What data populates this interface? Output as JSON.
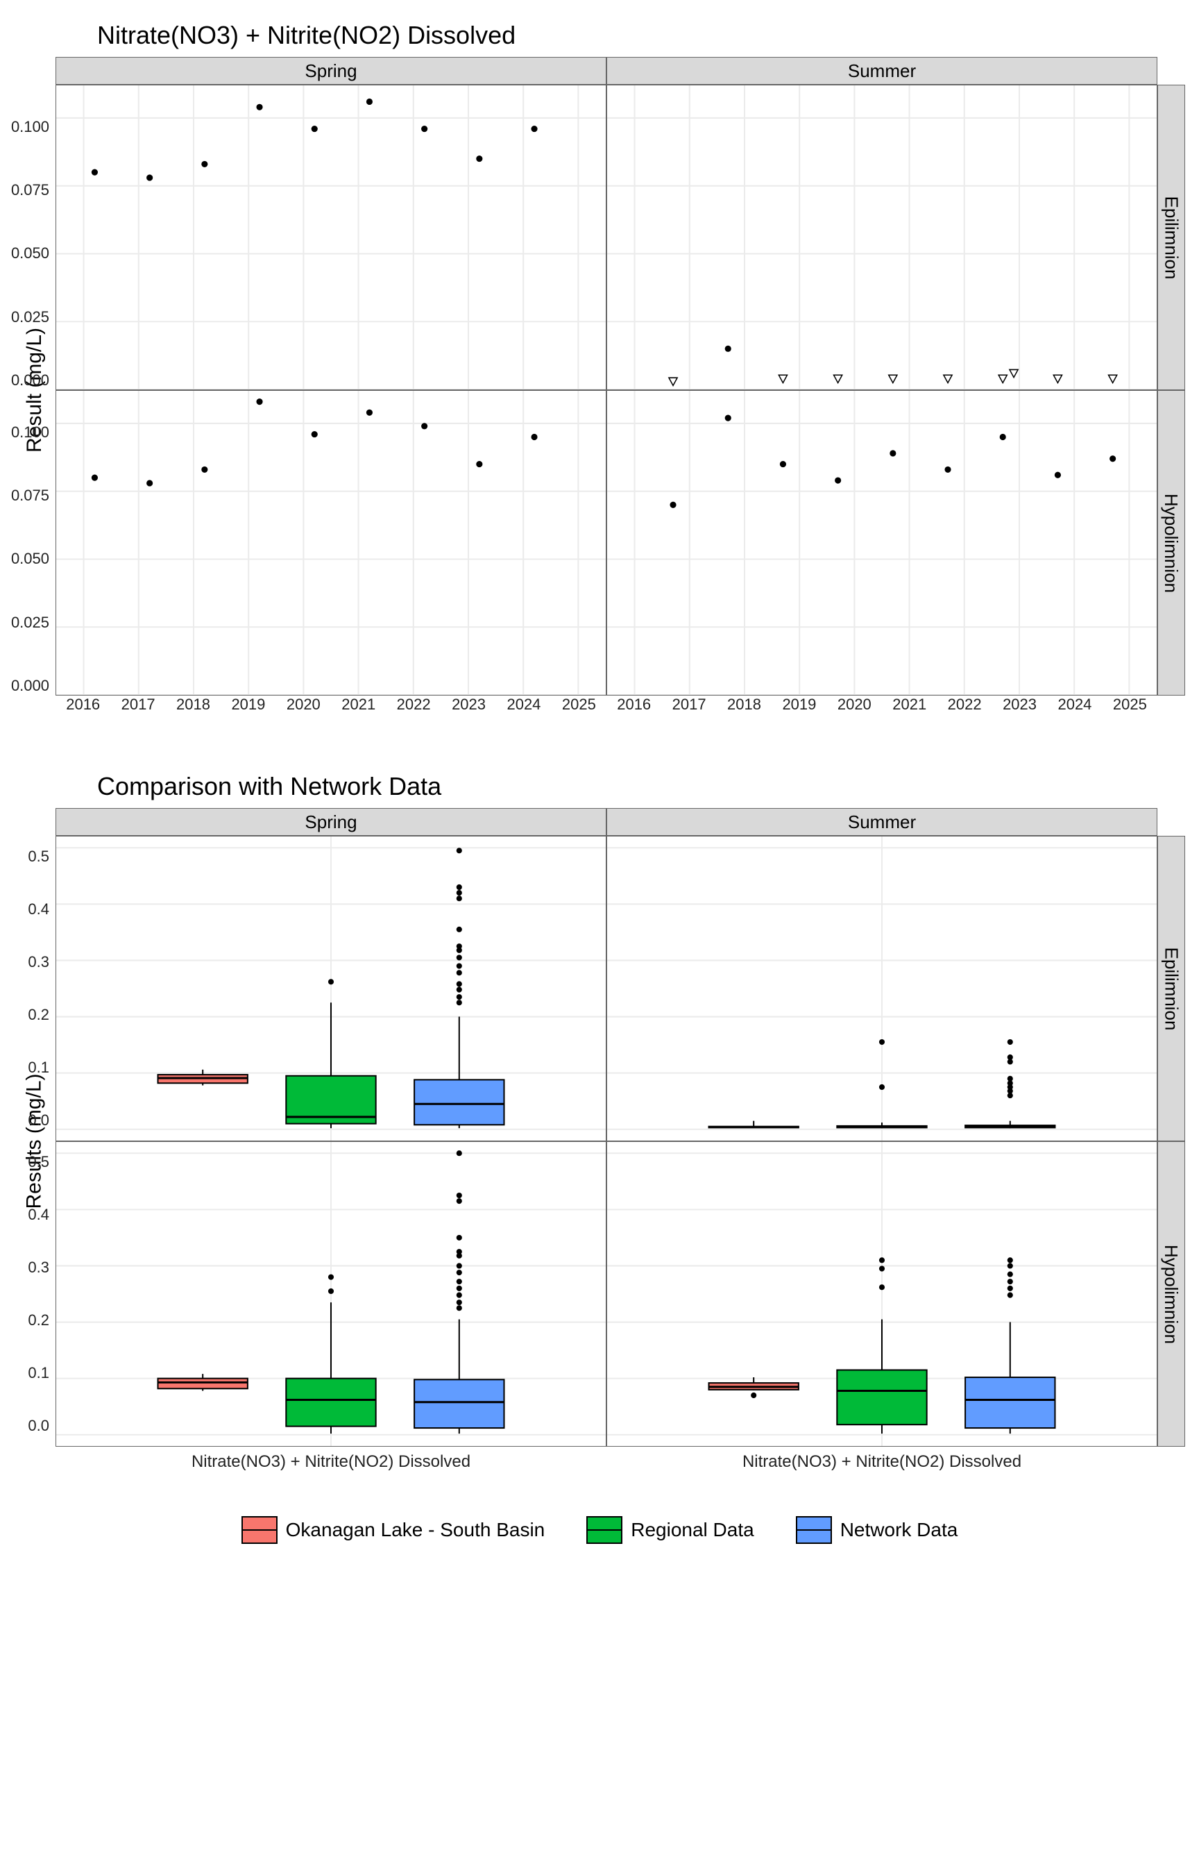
{
  "chart_data": [
    {
      "type": "scatter",
      "title": "Nitrate(NO3) + Nitrite(NO2) Dissolved",
      "ylabel": "Result (mg/L)",
      "xlim": [
        2015.5,
        2025.5
      ],
      "ylim": [
        0,
        0.112
      ],
      "x_ticks": [
        2016,
        2017,
        2018,
        2019,
        2020,
        2021,
        2022,
        2023,
        2024,
        2025
      ],
      "y_ticks": [
        0.0,
        0.025,
        0.05,
        0.075,
        0.1
      ],
      "col_facets": [
        "Spring",
        "Summer"
      ],
      "row_facets": [
        "Epilimnion",
        "Hypolimnion"
      ],
      "panels": {
        "Spring_Epilimnion": {
          "points": [
            {
              "x": 2016.2,
              "y": 0.08
            },
            {
              "x": 2017.2,
              "y": 0.078
            },
            {
              "x": 2018.2,
              "y": 0.083
            },
            {
              "x": 2019.2,
              "y": 0.104
            },
            {
              "x": 2020.2,
              "y": 0.096
            },
            {
              "x": 2021.2,
              "y": 0.106
            },
            {
              "x": 2022.2,
              "y": 0.096
            },
            {
              "x": 2023.2,
              "y": 0.085
            },
            {
              "x": 2024.2,
              "y": 0.096
            }
          ],
          "open": []
        },
        "Summer_Epilimnion": {
          "points": [
            {
              "x": 2017.7,
              "y": 0.015
            }
          ],
          "open": [
            {
              "x": 2016.7,
              "y": 0.003
            },
            {
              "x": 2018.7,
              "y": 0.004
            },
            {
              "x": 2019.7,
              "y": 0.004
            },
            {
              "x": 2020.7,
              "y": 0.004
            },
            {
              "x": 2021.7,
              "y": 0.004
            },
            {
              "x": 2022.7,
              "y": 0.004
            },
            {
              "x": 2022.9,
              "y": 0.006
            },
            {
              "x": 2023.7,
              "y": 0.004
            },
            {
              "x": 2024.7,
              "y": 0.004
            }
          ]
        },
        "Spring_Hypolimnion": {
          "points": [
            {
              "x": 2016.2,
              "y": 0.08
            },
            {
              "x": 2017.2,
              "y": 0.078
            },
            {
              "x": 2018.2,
              "y": 0.083
            },
            {
              "x": 2019.2,
              "y": 0.108
            },
            {
              "x": 2020.2,
              "y": 0.096
            },
            {
              "x": 2021.2,
              "y": 0.104
            },
            {
              "x": 2022.2,
              "y": 0.099
            },
            {
              "x": 2023.2,
              "y": 0.085
            },
            {
              "x": 2024.2,
              "y": 0.095
            }
          ],
          "open": []
        },
        "Summer_Hypolimnion": {
          "points": [
            {
              "x": 2016.7,
              "y": 0.07
            },
            {
              "x": 2017.7,
              "y": 0.102
            },
            {
              "x": 2018.7,
              "y": 0.085
            },
            {
              "x": 2019.7,
              "y": 0.079
            },
            {
              "x": 2020.7,
              "y": 0.089
            },
            {
              "x": 2021.7,
              "y": 0.083
            },
            {
              "x": 2022.7,
              "y": 0.095
            },
            {
              "x": 2023.7,
              "y": 0.081
            },
            {
              "x": 2024.7,
              "y": 0.087
            }
          ],
          "open": []
        }
      }
    },
    {
      "type": "boxplot",
      "title": "Comparison with Network Data",
      "ylabel": "Results (mg/L)",
      "ylim": [
        -0.02,
        0.52
      ],
      "y_ticks": [
        0.0,
        0.1,
        0.2,
        0.3,
        0.4,
        0.5
      ],
      "x_category": "Nitrate(NO3) + Nitrite(NO2) Dissolved",
      "col_facets": [
        "Spring",
        "Summer"
      ],
      "row_facets": [
        "Epilimnion",
        "Hypolimnion"
      ],
      "series": [
        {
          "name": "Okanagan Lake - South Basin",
          "color": "#F8766D"
        },
        {
          "name": "Regional Data",
          "color": "#00BA38"
        },
        {
          "name": "Network Data",
          "color": "#619CFF"
        }
      ],
      "panels": {
        "Spring_Epilimnion": [
          {
            "series": 0,
            "q1": 0.082,
            "med": 0.091,
            "q3": 0.097,
            "lw": 0.078,
            "uw": 0.106,
            "out": []
          },
          {
            "series": 1,
            "q1": 0.01,
            "med": 0.022,
            "q3": 0.095,
            "lw": 0.002,
            "uw": 0.225,
            "out": [
              0.262
            ]
          },
          {
            "series": 2,
            "q1": 0.008,
            "med": 0.045,
            "q3": 0.088,
            "lw": 0.002,
            "uw": 0.2,
            "out": [
              0.225,
              0.235,
              0.248,
              0.258,
              0.278,
              0.29,
              0.305,
              0.318,
              0.325,
              0.355,
              0.41,
              0.42,
              0.43,
              0.495
            ]
          }
        ],
        "Summer_Epilimnion": [
          {
            "series": 0,
            "q1": 0.003,
            "med": 0.004,
            "q3": 0.005,
            "lw": 0.003,
            "uw": 0.015,
            "out": []
          },
          {
            "series": 1,
            "q1": 0.003,
            "med": 0.004,
            "q3": 0.006,
            "lw": 0.002,
            "uw": 0.012,
            "out": [
              0.075,
              0.155
            ]
          },
          {
            "series": 2,
            "q1": 0.003,
            "med": 0.004,
            "q3": 0.007,
            "lw": 0.002,
            "uw": 0.015,
            "out": [
              0.06,
              0.068,
              0.075,
              0.082,
              0.09,
              0.12,
              0.128,
              0.155
            ]
          }
        ],
        "Spring_Hypolimnion": [
          {
            "series": 0,
            "q1": 0.082,
            "med": 0.093,
            "q3": 0.1,
            "lw": 0.078,
            "uw": 0.108,
            "out": []
          },
          {
            "series": 1,
            "q1": 0.015,
            "med": 0.062,
            "q3": 0.1,
            "lw": 0.002,
            "uw": 0.235,
            "out": [
              0.255,
              0.28
            ]
          },
          {
            "series": 2,
            "q1": 0.012,
            "med": 0.058,
            "q3": 0.098,
            "lw": 0.002,
            "uw": 0.205,
            "out": [
              0.225,
              0.235,
              0.248,
              0.26,
              0.272,
              0.288,
              0.3,
              0.318,
              0.325,
              0.35,
              0.415,
              0.425,
              0.5
            ]
          }
        ],
        "Summer_Hypolimnion": [
          {
            "series": 0,
            "q1": 0.08,
            "med": 0.085,
            "q3": 0.092,
            "lw": 0.079,
            "uw": 0.102,
            "out": [
              0.07
            ]
          },
          {
            "series": 1,
            "q1": 0.018,
            "med": 0.078,
            "q3": 0.115,
            "lw": 0.002,
            "uw": 0.205,
            "out": [
              0.262,
              0.295,
              0.31
            ]
          },
          {
            "series": 2,
            "q1": 0.012,
            "med": 0.062,
            "q3": 0.102,
            "lw": 0.002,
            "uw": 0.2,
            "out": [
              0.248,
              0.26,
              0.272,
              0.285,
              0.3,
              0.31
            ]
          }
        ]
      }
    }
  ],
  "legend": {
    "items": [
      "Okanagan Lake - South Basin",
      "Regional Data",
      "Network Data"
    ],
    "colors": [
      "#F8766D",
      "#00BA38",
      "#619CFF"
    ]
  }
}
